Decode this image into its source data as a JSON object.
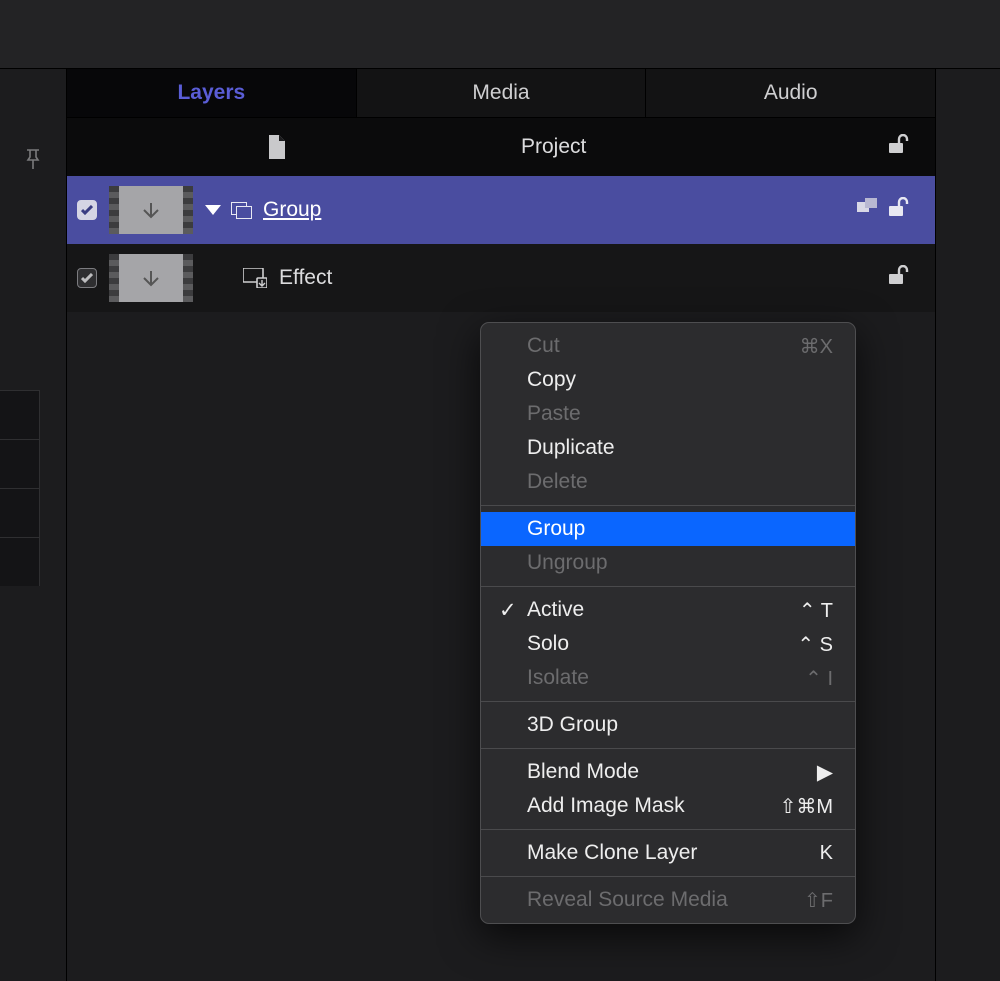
{
  "tabs": {
    "layers": "Layers",
    "media": "Media",
    "audio": "Audio"
  },
  "rows": {
    "project": {
      "label": "Project"
    },
    "group": {
      "label": "Group"
    },
    "effect": {
      "label": "Effect"
    }
  },
  "menu": {
    "cut": "Cut",
    "cut_sc": "⌘X",
    "copy": "Copy",
    "paste": "Paste",
    "duplicate": "Duplicate",
    "delete": "Delete",
    "group": "Group",
    "ungroup": "Ungroup",
    "active": "Active",
    "active_sc": "⌃ T",
    "solo": "Solo",
    "solo_sc": "⌃ S",
    "isolate": "Isolate",
    "isolate_sc": "⌃ I",
    "threed": "3D Group",
    "blend": "Blend Mode",
    "mask": "Add Image Mask",
    "mask_sc": "⇧⌘M",
    "clone": "Make Clone Layer",
    "clone_sc": "K",
    "reveal": "Reveal Source Media",
    "reveal_sc": "⇧F"
  }
}
